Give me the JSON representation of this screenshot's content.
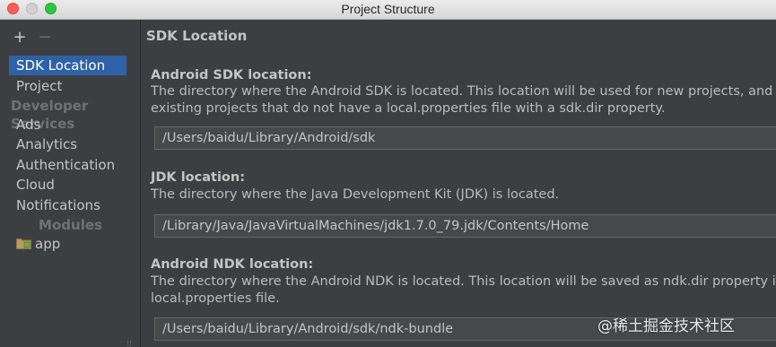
{
  "window": {
    "title": "Project Structure"
  },
  "sidebar": {
    "add_glyph": "+",
    "remove_glyph": "−",
    "items_top": [
      {
        "label": "SDK Location",
        "selected": true
      },
      {
        "label": "Project",
        "selected": false
      }
    ],
    "developer_services_heading": "Developer Services",
    "services": [
      {
        "label": "Ads"
      },
      {
        "label": "Analytics"
      },
      {
        "label": "Authentication"
      },
      {
        "label": "Cloud"
      },
      {
        "label": "Notifications"
      }
    ],
    "modules_heading": "Modules",
    "modules": [
      {
        "label": "app",
        "icon": "module-folder-icon"
      }
    ]
  },
  "main": {
    "title": "SDK Location",
    "android_sdk": {
      "heading": "Android SDK location:",
      "desc_line1": "The directory where the Android SDK is located. This location will be used for new projects, and for",
      "desc_line2": "existing projects that do not have a local.properties file with a sdk.dir property.",
      "value": "/Users/baidu/Library/Android/sdk"
    },
    "jdk": {
      "heading": "JDK location:",
      "desc_line1": "The directory where the Java Development Kit (JDK) is located.",
      "value": "/Library/Java/JavaVirtualMachines/jdk1.7.0_79.jdk/Contents/Home"
    },
    "android_ndk": {
      "heading": "Android NDK location:",
      "desc_line1": "The directory where the Android NDK is located. This location will be saved as ndk.dir property in the",
      "desc_line2": "local.properties file.",
      "value": "/Users/baidu/Library/Android/sdk/ndk-bundle"
    }
  },
  "watermark": "@稀土掘金技术社区",
  "colors": {
    "selection": "#2e61a5",
    "background": "#3c3f41",
    "field_background": "#45494a"
  }
}
